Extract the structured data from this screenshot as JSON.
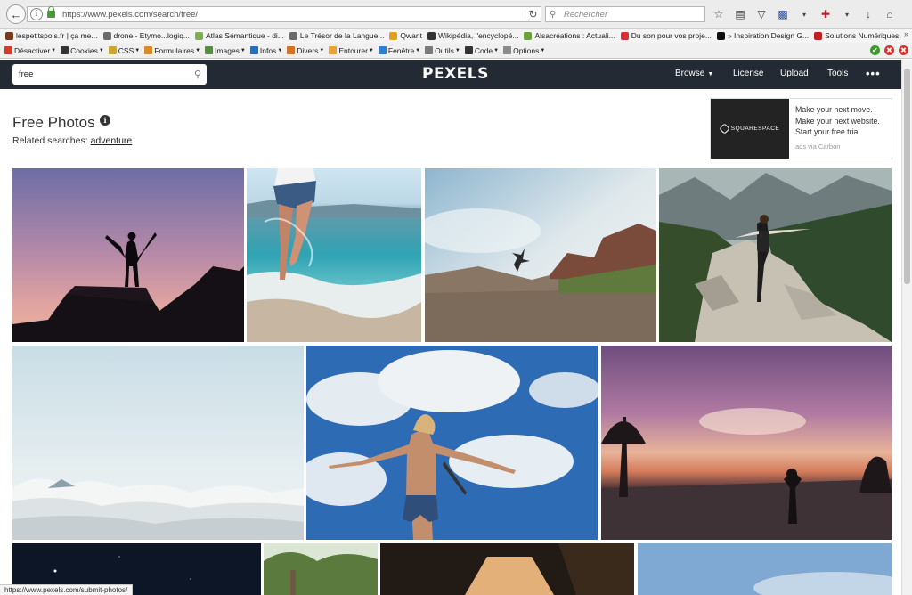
{
  "browser": {
    "url": "https://www.pexels.com/search/free/",
    "search_placeholder": "Rechercher",
    "bookmarks": [
      {
        "label": "lespetitspois.fr | ça me...",
        "color": "#7a3b1c"
      },
      {
        "label": "drone - Etymo...logiq...",
        "color": "#6b6b6b"
      },
      {
        "label": "Atlas Sémantique - di...",
        "color": "#7bb04a"
      },
      {
        "label": "Le Trésor de la Langue...",
        "color": "#6b6b6b"
      },
      {
        "label": "Qwant",
        "color": "#e0a020"
      },
      {
        "label": "Wikipédia, l'encyclopé...",
        "color": "#333333"
      },
      {
        "label": "Alsacréations : Actuali...",
        "color": "#6aa33a"
      },
      {
        "label": "Du son pour vos proje...",
        "color": "#d83030"
      },
      {
        "label": "» Inspiration Design G...",
        "color": "#111111"
      },
      {
        "label": "Solutions Numériques...",
        "color": "#c02020"
      }
    ],
    "dev_toolbar": [
      {
        "label": "Désactiver",
        "color": "#d43b2f"
      },
      {
        "label": "Cookies",
        "color": "#333333"
      },
      {
        "label": "CSS",
        "color": "#caa53a"
      },
      {
        "label": "Formulaires",
        "color": "#d98b2b"
      },
      {
        "label": "Images",
        "color": "#5a8a4a"
      },
      {
        "label": "Infos",
        "color": "#2a6bc2"
      },
      {
        "label": "Divers",
        "color": "#d0742a"
      },
      {
        "label": "Entourer",
        "color": "#e6a33a"
      },
      {
        "label": "Fenêtre",
        "color": "#2f7ed1"
      },
      {
        "label": "Outils",
        "color": "#7a7a7a"
      },
      {
        "label": "Code",
        "color": "#333333"
      },
      {
        "label": "Options",
        "color": "#8a8a8a"
      }
    ],
    "status_url": "https://www.pexels.com/submit-photos/"
  },
  "site": {
    "search_value": "free",
    "logo": "PEXELS",
    "nav": {
      "browse": "Browse",
      "license": "License",
      "upload": "Upload",
      "tools": "Tools",
      "more": "•••"
    }
  },
  "page": {
    "title": "Free Photos",
    "related_prefix": "Related searches:",
    "related_link": "adventure"
  },
  "ad": {
    "brand": "SQUARESPACE",
    "lines": [
      "Make your next move.",
      "Make your next website.",
      "Start your free trial."
    ],
    "via": "ads via Carbon"
  },
  "photos": [
    {
      "name": "photo-sunset-silhouette"
    },
    {
      "name": "photo-beach-legs"
    },
    {
      "name": "photo-jumping-person"
    },
    {
      "name": "photo-mountain-hiker"
    },
    {
      "name": "photo-clouds-above"
    },
    {
      "name": "photo-woman-sky"
    },
    {
      "name": "photo-purple-sunset-field"
    },
    {
      "name": "photo-night-sky"
    },
    {
      "name": "photo-trees"
    },
    {
      "name": "photo-bridge"
    },
    {
      "name": "photo-blue-sky"
    }
  ]
}
